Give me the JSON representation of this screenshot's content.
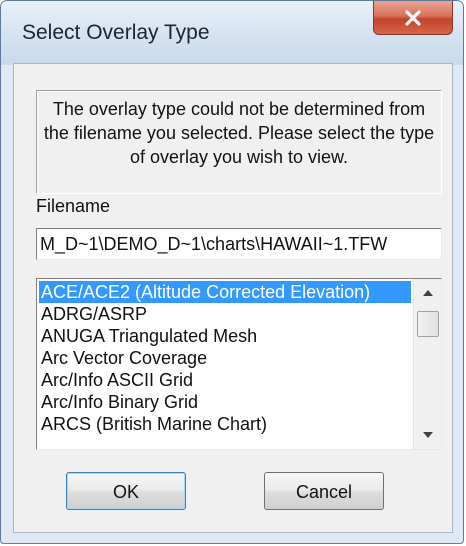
{
  "window": {
    "title": "Select Overlay Type",
    "close_icon": "close-icon"
  },
  "message": "The overlay type could not be determined from the filename you selected.  Please select the type of overlay you wish to view.",
  "filename": {
    "label": "Filename",
    "value": "M_D~1\\DEMO_D~1\\charts\\HAWAII~1.TFW"
  },
  "overlay_types": {
    "selected_index": 0,
    "items": [
      "ACE/ACE2 (Altitude Corrected Elevation)",
      "ADRG/ASRP",
      "ANUGA Triangulated Mesh",
      "Arc Vector Coverage",
      "Arc/Info ASCII Grid",
      "Arc/Info Binary Grid",
      "ARCS (British Marine Chart)"
    ]
  },
  "buttons": {
    "ok": "OK",
    "cancel": "Cancel"
  },
  "colors": {
    "selection": "#3399ff",
    "close_button": "#c4432b"
  }
}
